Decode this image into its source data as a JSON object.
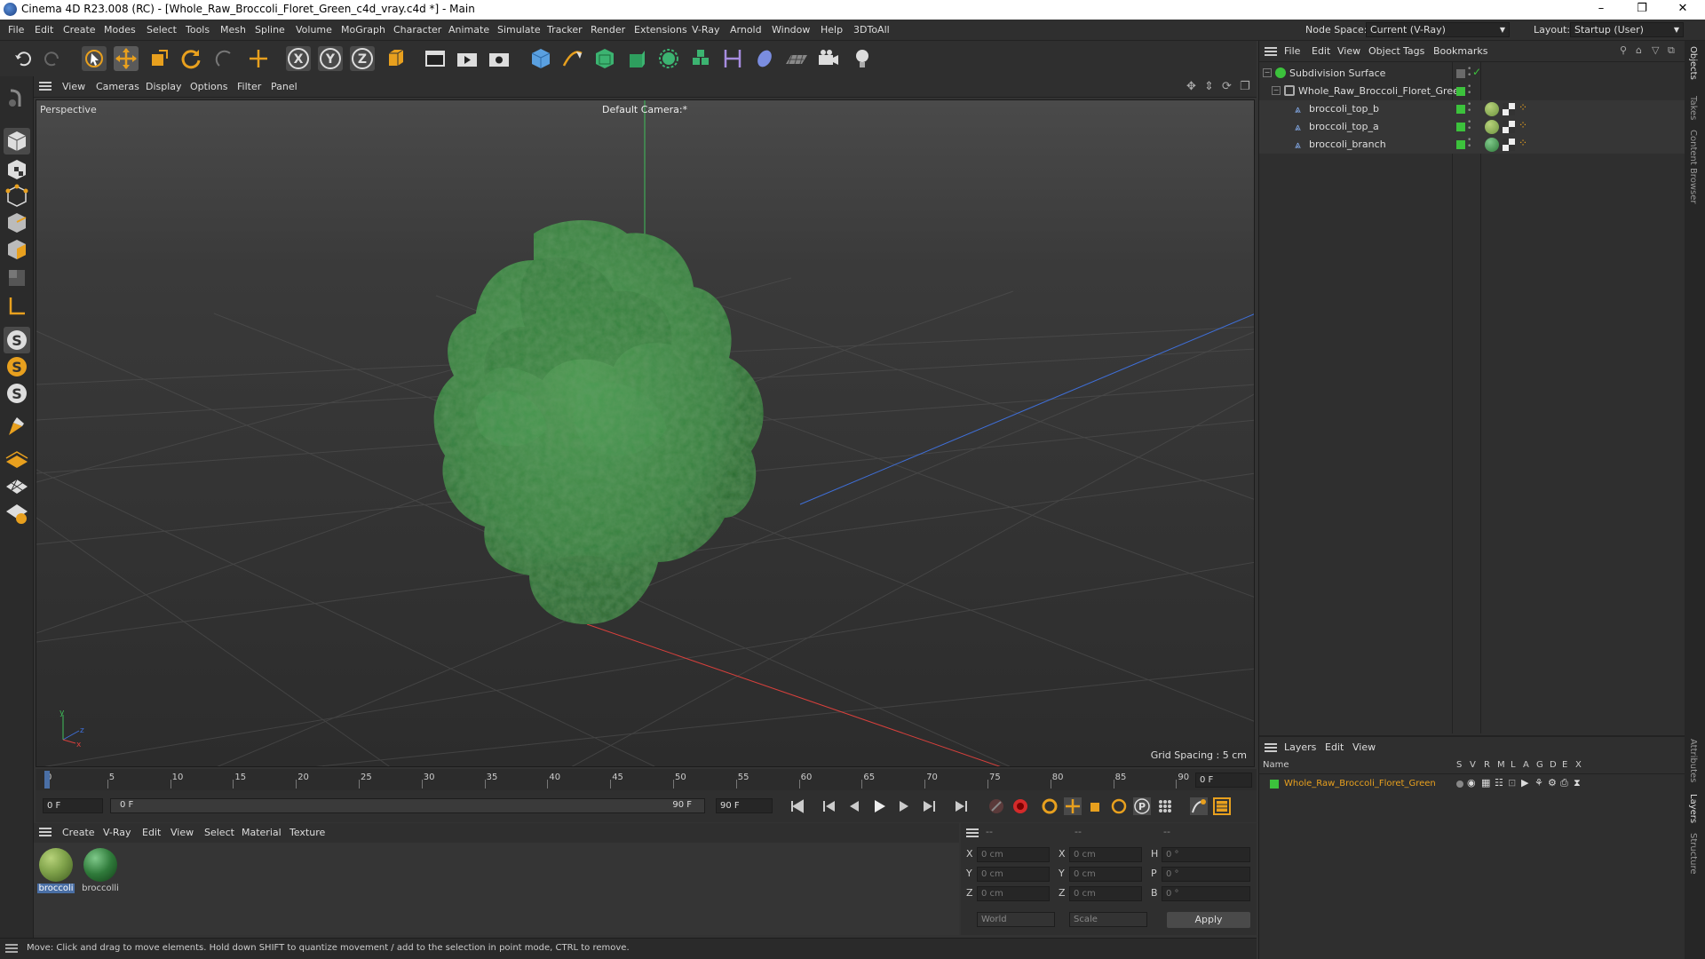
{
  "window": {
    "title": "Cinema 4D R23.008 (RC) - [Whole_Raw_Broccoli_Floret_Green_c4d_vray.c4d *] - Main",
    "minimize": "–",
    "maximize": "❐",
    "close": "✕"
  },
  "menu": [
    "File",
    "Edit",
    "Create",
    "Modes",
    "Select",
    "Tools",
    "Mesh",
    "Spline",
    "Volume",
    "MoGraph",
    "Character",
    "Animate",
    "Simulate",
    "Tracker",
    "Render",
    "Extensions",
    "V-Ray",
    "Arnold",
    "Window",
    "Help",
    "3DToAll"
  ],
  "node_space": {
    "label": "Node Space:",
    "value": "Current (V-Ray)"
  },
  "layout": {
    "label": "Layout:",
    "value": "Startup (User)"
  },
  "viewport": {
    "menu": [
      "View",
      "Cameras",
      "Display",
      "Options",
      "Filter",
      "Panel"
    ],
    "name": "Perspective",
    "camera": "Default Camera:*",
    "grid_spacing": "Grid Spacing : 5 cm"
  },
  "timeline": {
    "ticks": [
      "0",
      "5",
      "10",
      "15",
      "20",
      "25",
      "30",
      "35",
      "40",
      "45",
      "50",
      "55",
      "60",
      "65",
      "70",
      "75",
      "80",
      "85",
      "90"
    ],
    "current_frame": "0 F"
  },
  "transport": {
    "start": "0 F",
    "range_start": "0 F",
    "range_end": "90 F",
    "end": "90 F"
  },
  "material_menu": [
    "Create",
    "V-Ray",
    "Edit",
    "View",
    "Select",
    "Material",
    "Texture"
  ],
  "materials": [
    {
      "label": "broccoli",
      "selected": true,
      "color": "#7fa24a"
    },
    {
      "label": "broccolli",
      "selected": false,
      "color": "#2f7a3a"
    }
  ],
  "coords": {
    "headers": [
      "--",
      "--",
      "--"
    ],
    "rows": [
      {
        "a": "X",
        "av": "0 cm",
        "b": "X",
        "bv": "0 cm",
        "c": "H",
        "cv": "0 °"
      },
      {
        "a": "Y",
        "av": "0 cm",
        "b": "Y",
        "bv": "0 cm",
        "c": "P",
        "cv": "0 °"
      },
      {
        "a": "Z",
        "av": "0 cm",
        "b": "Z",
        "bv": "0 cm",
        "c": "B",
        "cv": "0 °"
      }
    ],
    "world": "World",
    "scale": "Scale",
    "apply": "Apply"
  },
  "status": "Move: Click and drag to move elements. Hold down SHIFT to quantize movement / add to the selection in point mode, CTRL to remove.",
  "objects_menu": [
    "File",
    "Edit",
    "View",
    "Object",
    "Tags",
    "Bookmarks"
  ],
  "objects": [
    {
      "name": "Subdivision Surface",
      "indent": 0
    },
    {
      "name": "Whole_Raw_Broccoli_Floret_Green",
      "indent": 1
    },
    {
      "name": "broccoli_top_b",
      "indent": 2
    },
    {
      "name": "broccoli_top_a",
      "indent": 2
    },
    {
      "name": "broccoli_branch",
      "indent": 2
    }
  ],
  "layers_menu": [
    "Layers",
    "Edit",
    "View"
  ],
  "layers_header": {
    "name": "Name",
    "flags": [
      "S",
      "V",
      "R",
      "M",
      "L",
      "A",
      "G",
      "D",
      "E",
      "X"
    ]
  },
  "layers": [
    {
      "name": "Whole_Raw_Broccoli_Floret_Green",
      "color": "#3cc23c"
    }
  ],
  "side_tabs": [
    "Objects",
    "Takes",
    "Content Browser",
    "Attributes",
    "Layers",
    "Structure"
  ],
  "colors": {
    "accent": "#e8a01e",
    "green": "#3cc23c",
    "selection": "#4a6fa5"
  }
}
